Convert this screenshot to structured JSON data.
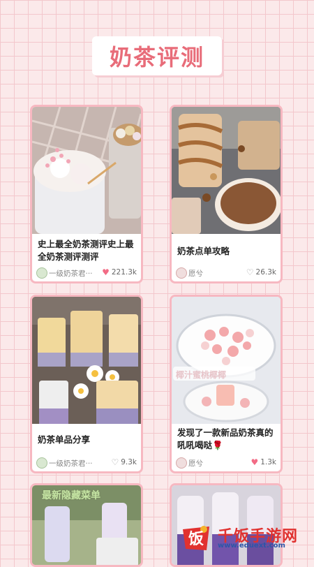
{
  "page": {
    "title": "奶茶评测"
  },
  "cards": [
    {
      "title": "史上最全奶茶测评史上最全奶茶测评测评",
      "author": "一级奶茶君···",
      "likes": "221.3k",
      "liked": true
    },
    {
      "title": "奶茶点单攻略",
      "author": "愿兮",
      "likes": "26.3k",
      "liked": false
    },
    {
      "title": "奶茶单品分享",
      "author": "一级奶茶君···",
      "likes": "9.3k",
      "liked": false
    },
    {
      "title": "发现了一款新品奶茶真的吼吼喝哒🌹",
      "author": "愿兮",
      "likes": "1.3k",
      "liked": true
    },
    {
      "overlay_text": "最新隐藏菜单"
    },
    {}
  ],
  "images": {
    "card4_overlay_text": "椰汁蜜桃椰椰"
  },
  "watermark": {
    "name": "千饭手游网",
    "url": "www.eduext.com",
    "logo_char": "饭"
  },
  "colors": {
    "accent": "#e86c79",
    "heart": "#f26b85",
    "border": "#f7b8c1"
  }
}
